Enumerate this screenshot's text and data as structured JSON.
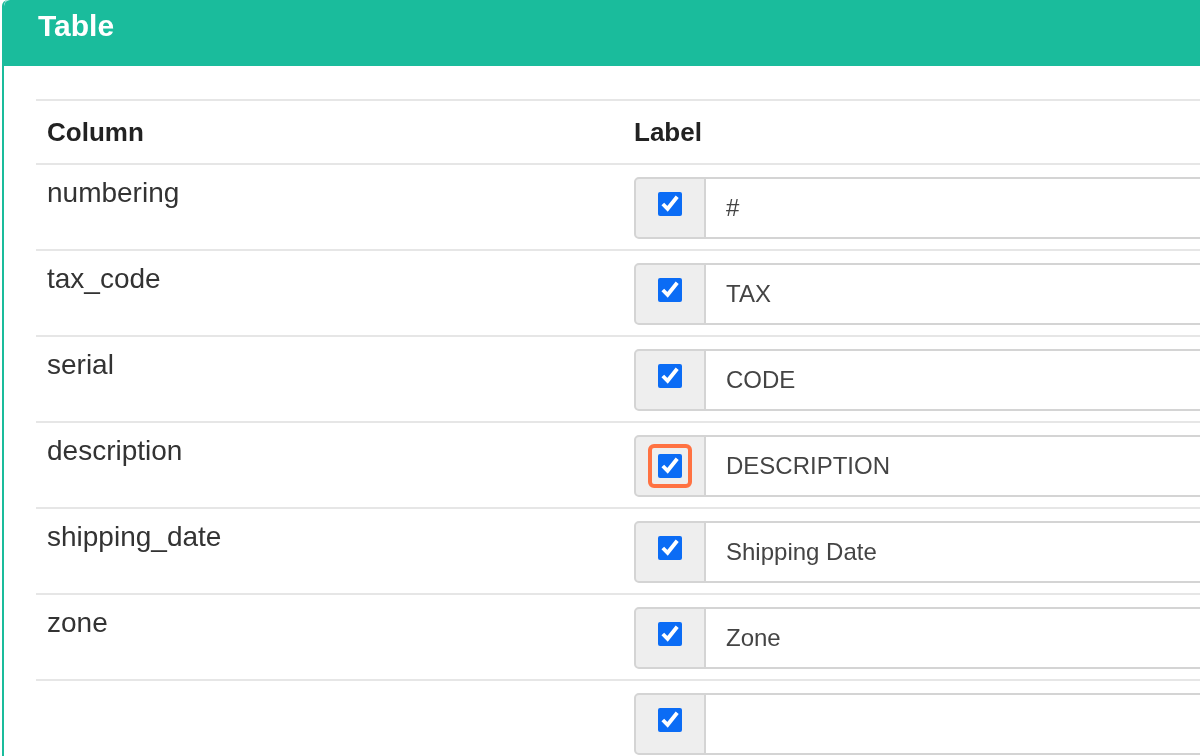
{
  "panel": {
    "title": "Table"
  },
  "table": {
    "columns": [
      "Column",
      "Label"
    ],
    "rows": [
      {
        "column": "numbering",
        "checked": true,
        "highlighted": false,
        "label": "#"
      },
      {
        "column": "tax_code",
        "checked": true,
        "highlighted": false,
        "label": "TAX"
      },
      {
        "column": "serial",
        "checked": true,
        "highlighted": false,
        "label": "CODE"
      },
      {
        "column": "description",
        "checked": true,
        "highlighted": true,
        "label": "DESCRIPTION"
      },
      {
        "column": "shipping_date",
        "checked": true,
        "highlighted": false,
        "label": "Shipping Date"
      },
      {
        "column": "zone",
        "checked": true,
        "highlighted": false,
        "label": "Zone"
      },
      {
        "checked": true,
        "highlighted": false
      }
    ]
  }
}
